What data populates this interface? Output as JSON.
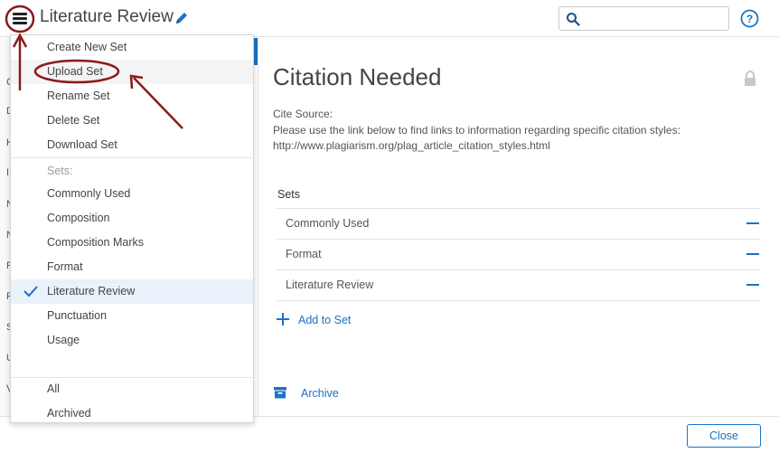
{
  "header": {
    "title": "Literature Review",
    "search_placeholder": ""
  },
  "menu": {
    "actions": [
      {
        "label": "Create New Set"
      },
      {
        "label": "Upload Set"
      },
      {
        "label": "Rename Set"
      },
      {
        "label": "Delete Set"
      },
      {
        "label": "Download Set"
      }
    ],
    "sets_heading": "Sets:",
    "sets": [
      {
        "label": "Commonly Used"
      },
      {
        "label": "Composition"
      },
      {
        "label": "Composition Marks"
      },
      {
        "label": "Format"
      },
      {
        "label": "Literature Review"
      },
      {
        "label": "Punctuation"
      },
      {
        "label": "Usage"
      }
    ],
    "bottom": [
      {
        "label": "All"
      },
      {
        "label": "Archived"
      }
    ]
  },
  "sidebar": {
    "letters": [
      "C",
      "D",
      "H",
      "I",
      "N",
      "N",
      "F",
      "F",
      "S",
      "U",
      "V"
    ]
  },
  "main": {
    "title": "Citation Needed",
    "cite_lines": [
      "Cite Source:",
      "Please use the link below to find links to information regarding specific citation styles:",
      "http://www.plagiarism.org/plag_article_citation_styles.html"
    ],
    "sets_heading": "Sets",
    "sets": [
      {
        "label": "Commonly Used"
      },
      {
        "label": "Format"
      },
      {
        "label": "Literature Review"
      }
    ],
    "add_to_set": "Add to Set",
    "archive": "Archive"
  },
  "footer": {
    "close_label": "Close"
  },
  "colors": {
    "accent": "#1a73c8",
    "annotation": "#8b1a1a",
    "selected_bg": "#e9f2fb"
  }
}
